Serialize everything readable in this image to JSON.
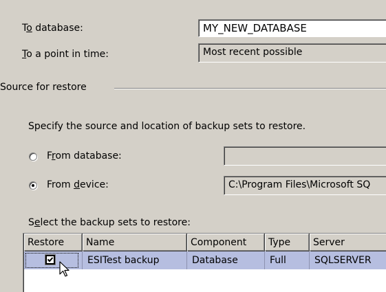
{
  "destination": {
    "to_database": {
      "label_pre": "T",
      "label_key": "o",
      "label_post": " database:",
      "value": "MY_NEW_DATABASE"
    },
    "to_point_in_time": {
      "label_pre": "",
      "label_key": "T",
      "label_post": "o a point in time:",
      "value": "Most recent possible"
    }
  },
  "source": {
    "group_title": "Source for restore",
    "instruction": "Specify the source and location of backup sets to restore.",
    "from_database": {
      "label_pre": "F",
      "label_key": "r",
      "label_post": "om database:",
      "value": "",
      "selected": false
    },
    "from_device": {
      "label_pre": "From ",
      "label_key": "d",
      "label_post": "evice:",
      "value": "C:\\Program Files\\Microsoft SQ",
      "selected": true
    }
  },
  "backup_sets": {
    "label_pre": "S",
    "label_key": "e",
    "label_post": "lect the backup sets to restore:",
    "columns": [
      "Restore",
      "Name",
      "Component",
      "Type",
      "Server"
    ],
    "rows": [
      {
        "restore": true,
        "name": "ESITest backup",
        "component": "Database",
        "type": "Full",
        "server": "SQLSERVER"
      }
    ]
  }
}
